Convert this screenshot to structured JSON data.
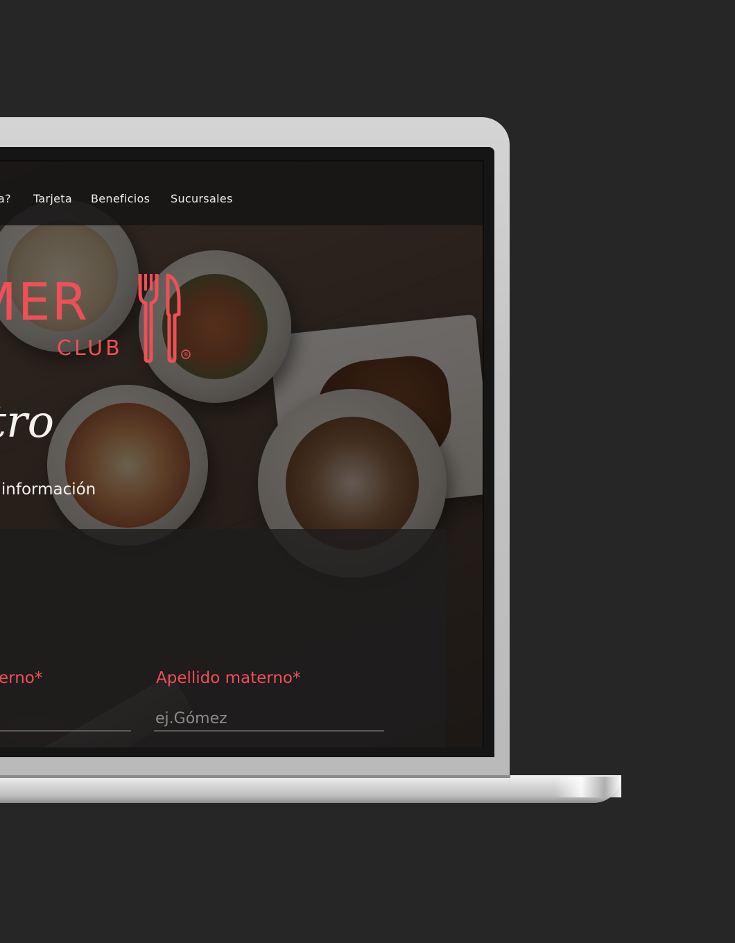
{
  "nav": {
    "items": [
      {
        "label": "a?"
      },
      {
        "label": "Tarjeta"
      },
      {
        "label": "Beneficios"
      },
      {
        "label": "Sucursales"
      }
    ]
  },
  "logo": {
    "main_text": "MER",
    "sub_text": "CLUB",
    "registered_mark": "®"
  },
  "page": {
    "title": "istro",
    "subtitle": "u información"
  },
  "form": {
    "fields": [
      {
        "label": "erno*",
        "value": "",
        "placeholder": ""
      },
      {
        "label": "Apellido materno*",
        "value": "",
        "placeholder": "ej.Gómez"
      }
    ]
  },
  "colors": {
    "accent": "#ef4f57",
    "background": "#262626",
    "navbar": "#161515",
    "text": "#f5f1ec"
  }
}
